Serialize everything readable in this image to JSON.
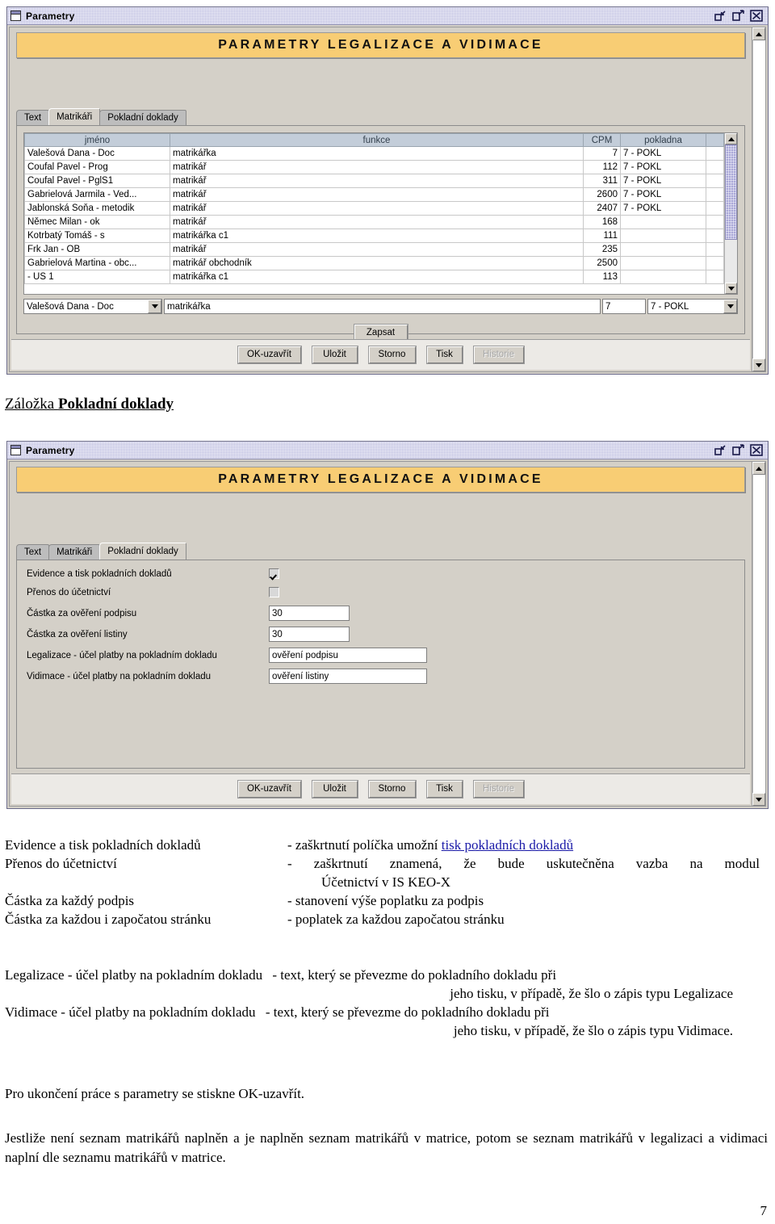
{
  "dialog1": {
    "window_title": "Parametry",
    "banner_title": "PARAMETRY LEGALIZACE A VIDIMACE",
    "tabs": [
      {
        "label": "Text",
        "selected": false
      },
      {
        "label": "Matrikáři",
        "selected": true
      },
      {
        "label": "Pokladní doklady",
        "selected": false
      }
    ],
    "table": {
      "columns": [
        "jméno",
        "funkce",
        "CPM",
        "pokladna",
        ""
      ],
      "rows": [
        {
          "jmeno": "Valešová Dana - Doc",
          "funkce": "matrikářka",
          "cpm": "7",
          "pokladna": "7 - POKL"
        },
        {
          "jmeno": "Coufal Pavel - Prog",
          "funkce": "matrikář",
          "cpm": "112",
          "pokladna": "7 - POKL"
        },
        {
          "jmeno": "Coufal Pavel - PglS1",
          "funkce": "matrikář",
          "cpm": "311",
          "pokladna": "7 - POKL"
        },
        {
          "jmeno": "Gabrielová Jarmila - Ved...",
          "funkce": "matrikář",
          "cpm": "2600",
          "pokladna": "7 - POKL"
        },
        {
          "jmeno": "Jablonská Soňa - metodik",
          "funkce": "matrikář",
          "cpm": "2407",
          "pokladna": "7 - POKL"
        },
        {
          "jmeno": "Němec Milan - ok",
          "funkce": "matrikář",
          "cpm": "168",
          "pokladna": ""
        },
        {
          "jmeno": "Kotrbatý Tomáš - s",
          "funkce": "matrikářka c1",
          "cpm": "111",
          "pokladna": ""
        },
        {
          "jmeno": "Frk Jan - OB",
          "funkce": "matrikář",
          "cpm": "235",
          "pokladna": ""
        },
        {
          "jmeno": "Gabrielová Martina - obc...",
          "funkce": "matrikář obchodník",
          "cpm": "2500",
          "pokladna": ""
        },
        {
          "jmeno": "- US 1",
          "funkce": "matrikářka c1",
          "cpm": "113",
          "pokladna": ""
        }
      ]
    },
    "editor": {
      "name_combo_value": "Valešová Dana - Doc",
      "funkce_value": "matrikářka",
      "cpm_value": "7",
      "pokladna_combo_value": "7 - POKL",
      "write_button": "Zapsat"
    },
    "buttons": [
      {
        "label": "OK-uzavřít",
        "disabled": false
      },
      {
        "label": "Uložit",
        "disabled": false
      },
      {
        "label": "Storno",
        "disabled": false
      },
      {
        "label": "Tisk",
        "disabled": false
      },
      {
        "label": "Historie",
        "disabled": true
      }
    ]
  },
  "section_heading": {
    "prefix": "Záložka ",
    "bold": "Pokladní doklady"
  },
  "dialog2": {
    "window_title": "Parametry",
    "banner_title": "PARAMETRY LEGALIZACE A VIDIMACE",
    "tabs": [
      {
        "label": "Text",
        "selected": false
      },
      {
        "label": "Matrikáři",
        "selected": false
      },
      {
        "label": "Pokladní doklady",
        "selected": true
      }
    ],
    "fields": [
      {
        "label": "Evidence a tisk pokladních dokladů",
        "type": "checkbox",
        "checked": true
      },
      {
        "label": "Přenos do účetnictví",
        "type": "checkbox",
        "checked": false
      },
      {
        "label": "Částka za ověření podpisu",
        "type": "text",
        "value": "30"
      },
      {
        "label": "Částka za ověření listiny",
        "type": "text",
        "value": "30"
      },
      {
        "label": "Legalizace - účel platby na pokladním dokladu",
        "type": "text-wide",
        "value": "ověření podpisu"
      },
      {
        "label": "Vidimace - účel platby na pokladním dokladu",
        "type": "text-wide",
        "value": "ověření listiny"
      }
    ],
    "buttons": [
      {
        "label": "OK-uzavřít",
        "disabled": false
      },
      {
        "label": "Uložit",
        "disabled": false
      },
      {
        "label": "Storno",
        "disabled": false
      },
      {
        "label": "Tisk",
        "disabled": false
      },
      {
        "label": "Historie",
        "disabled": true
      }
    ]
  },
  "definitions": [
    {
      "term": "Evidence a tisk pokladních dokladů",
      "desc_pre": "- zaškrtnutí políčka umožní ",
      "desc_link": "tisk pokladních dokladů",
      "desc_post": "",
      "desc_cont": ""
    },
    {
      "term": "Přenos do účetnictví",
      "desc_pre": "- zaškrtnutí znamená, že bude uskutečněna vazba na modul",
      "desc_link": "",
      "desc_post": "",
      "desc_cont": "Účetnictví v IS KEO-X"
    },
    {
      "term": "Částka za každý podpis",
      "desc_pre": "- stanovení výše poplatku za podpis",
      "desc_link": "",
      "desc_post": "",
      "desc_cont": ""
    },
    {
      "term": "Částka za každou i započatou stránku",
      "desc_pre": "- poplatek za každou započatou stránku",
      "desc_link": "",
      "desc_post": "",
      "desc_cont": ""
    }
  ],
  "definitions_wide": [
    {
      "term": "Legalizace - účel platby na pokladním dokladu",
      "desc": "- text, který se převezme do pokladního dokladu při",
      "desc_cont": "jeho tisku, v případě, že šlo o zápis typu Legalizace"
    },
    {
      "term": "Vidimace - účel platby na pokladním dokladu",
      "desc": "- text, který se převezme do pokladního dokladu při",
      "desc_cont": "jeho tisku, v případě, že šlo o zápis typu Vidimace."
    }
  ],
  "closing_paragraph": "Pro ukončení práce s parametry se stiskne OK-uzavřít.",
  "final_paragraph": "Jestliže není seznam matrikářů naplněn a je naplněn seznam matrikářů v matrice, potom se seznam matrikářů v legalizaci a vidimaci naplní dle seznamu matrikářů v matrice.",
  "page_number": "7",
  "colors": {
    "banner": "#f8cd74",
    "titlebar": "#b4b4dc",
    "dialog_face": "#d4d0c8",
    "header_cell": "#c3cdd9",
    "link": "#1a1aa8"
  }
}
